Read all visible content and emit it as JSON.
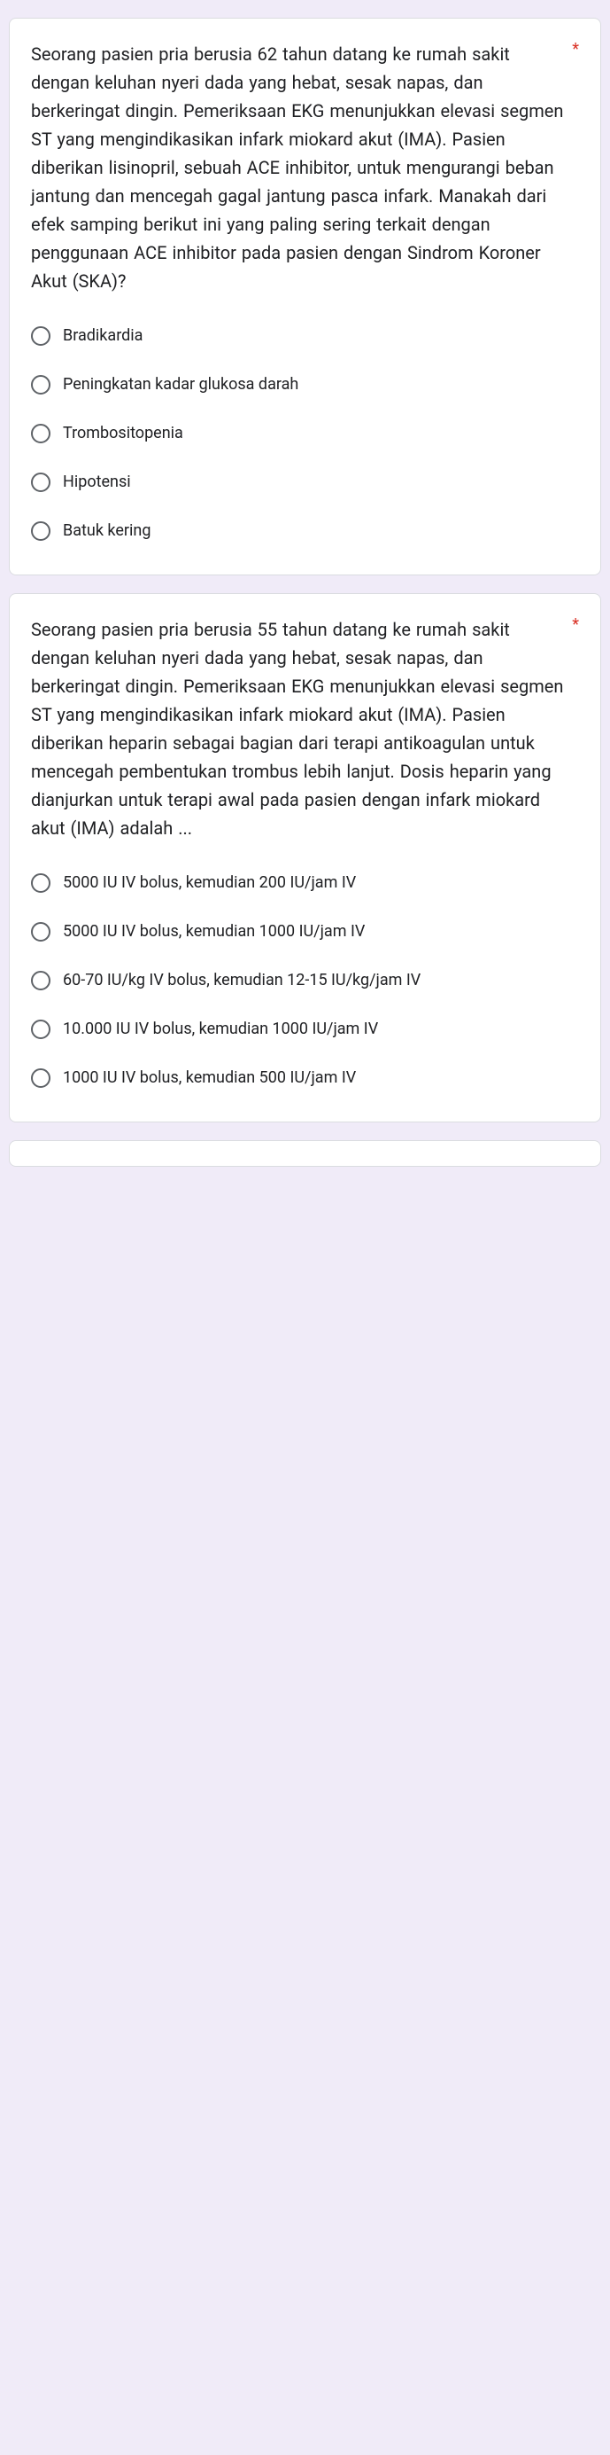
{
  "questions": [
    {
      "text": "Seorang pasien pria berusia 62 tahun datang ke rumah sakit dengan keluhan nyeri dada yang hebat, sesak napas, dan berkeringat dingin. Pemeriksaan EKG menunjukkan elevasi segmen ST yang mengindikasikan infark miokard akut (IMA). Pasien diberikan lisinopril, sebuah ACE inhibitor, untuk mengurangi beban jantung dan mencegah gagal jantung pasca infark. Manakah dari efek samping berikut ini yang paling sering terkait dengan penggunaan ACE inhibitor pada pasien dengan Sindrom Koroner Akut (SKA)?",
      "required": "*",
      "options": [
        "Bradikardia",
        "Peningkatan kadar glukosa darah",
        "Trombositopenia",
        "Hipotensi",
        "Batuk kering"
      ]
    },
    {
      "text": "Seorang pasien pria berusia 55 tahun datang ke rumah sakit dengan keluhan nyeri dada yang hebat, sesak napas, dan berkeringat dingin. Pemeriksaan EKG menunjukkan elevasi segmen ST yang mengindikasikan infark miokard akut (IMA). Pasien diberikan heparin sebagai bagian dari terapi antikoagulan untuk mencegah pembentukan trombus lebih lanjut. Dosis heparin yang dianjurkan untuk terapi awal pada pasien dengan infark miokard akut (IMA) adalah ...",
      "required": "*",
      "options": [
        "5000 IU IV bolus, kemudian 200 IU/jam IV",
        "5000 IU IV bolus, kemudian 1000 IU/jam IV",
        "60-70 IU/kg IV bolus, kemudian 12-15 IU/kg/jam IV",
        "10.000 IU IV bolus, kemudian 1000 IU/jam IV",
        "1000 IU IV bolus, kemudian 500 IU/jam IV"
      ]
    }
  ]
}
